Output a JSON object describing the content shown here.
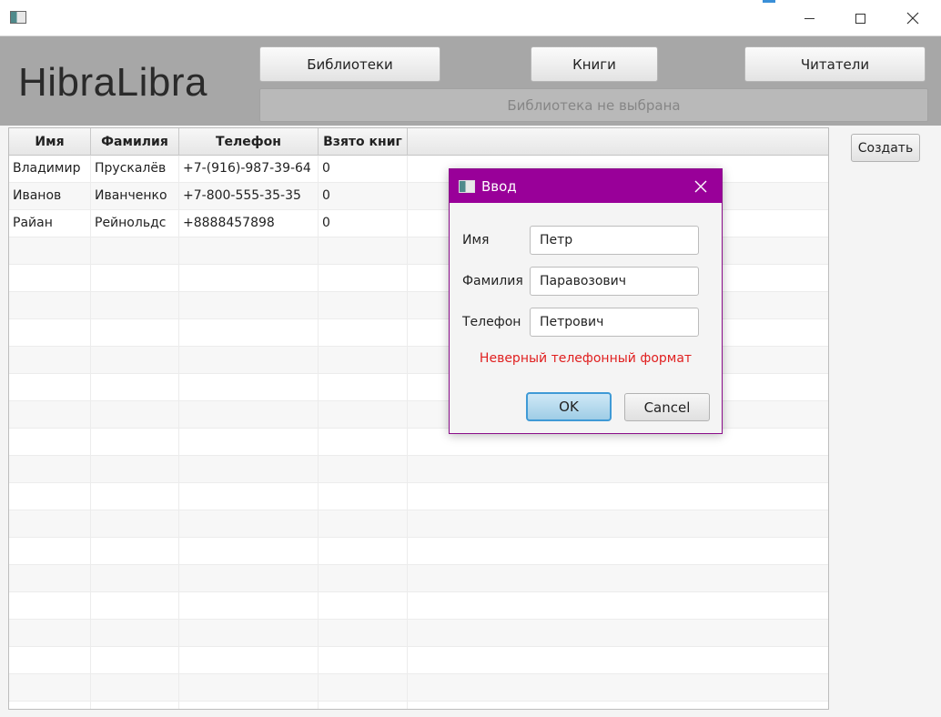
{
  "window": {
    "app_icon": "app-window-icon",
    "controls": [
      "minimize-icon",
      "maximize-icon",
      "close-icon"
    ]
  },
  "header": {
    "brand": "HibraLibra",
    "nav": {
      "libraries": "Библиотеки",
      "books": "Книги",
      "readers": "Читатели"
    },
    "library_status": "Библиотека не выбрана"
  },
  "table": {
    "columns": [
      "Имя",
      "Фамилия",
      "Телефон",
      "Взято книг",
      ""
    ],
    "rows": [
      [
        "Владимир",
        "Прускалёв",
        "+7-(916)-987-39-64",
        "0"
      ],
      [
        "Иванов",
        "Иванченко",
        "+7-800-555-35-35",
        "0"
      ],
      [
        "Райан",
        "Рейнольдс",
        "+8888457898",
        "0"
      ]
    ]
  },
  "actions": {
    "create": "Создать"
  },
  "dialog": {
    "title": "Ввод",
    "fields": [
      {
        "label": "Имя",
        "value": "Петр"
      },
      {
        "label": "Фамилия",
        "value": "Паравозович"
      },
      {
        "label": "Телефон",
        "value": "Петрович"
      }
    ],
    "error": "Неверный телефонный формат",
    "ok": "OK",
    "cancel": "Cancel",
    "title_color": "#990099",
    "error_color": "#e02020"
  }
}
